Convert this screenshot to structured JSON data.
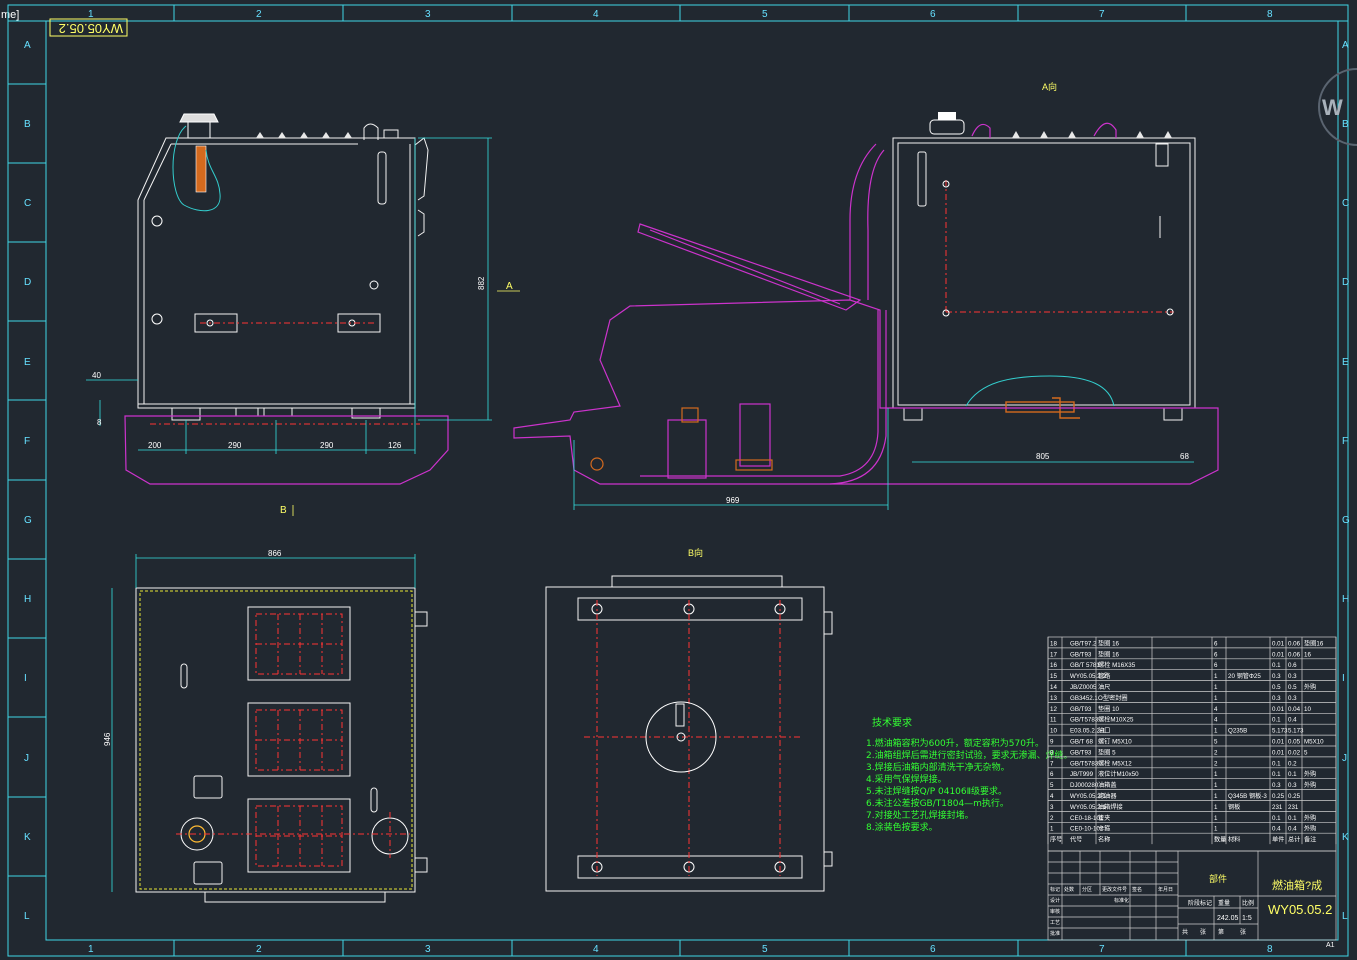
{
  "window": {
    "title_fragment": "me]"
  },
  "drawing": {
    "code_stamp": "WY05.05.2",
    "watermark": "W",
    "sheet_size": "A1",
    "grid_columns": [
      "1",
      "2",
      "3",
      "4",
      "5",
      "6",
      "7",
      "8"
    ],
    "grid_rows": [
      "A",
      "B",
      "C",
      "D",
      "E",
      "F",
      "G",
      "H",
      "I",
      "J",
      "K",
      "L"
    ]
  },
  "views": {
    "view_a_label": "A向",
    "view_b_label": "B向",
    "arrow_a": "A",
    "arrow_b": "B"
  },
  "dimensions": {
    "d40": "40",
    "d8": "8",
    "d200": "200",
    "d290a": "290",
    "d290b": "290",
    "d126": "126",
    "d882": "882",
    "d969": "969",
    "d805": "805",
    "d68": "68",
    "d866": "866",
    "d946": "946"
  },
  "tech_notes": {
    "title": "技术要求",
    "lines": [
      "1.燃油箱容积为600升，额定容积为570升。",
      "2.油箱组焊后需进行密封试验，要求无渗漏、焊缝。",
      "3.焊接后油箱内部清洗干净无杂物。",
      "4.采用气保焊焊接。",
      "5.未注焊缝按Q/P 04106Ⅱ级要求。",
      "6.未注公差按GB/T1804—m执行。",
      "7.对接处工艺孔焊接封堵。",
      "8.涂装色按要求。"
    ]
  },
  "bom": {
    "rows": [
      {
        "no": "18",
        "code": "GB/T97.2",
        "name": "垫圈 16",
        "qty": "6",
        "mat": "",
        "w1": "0.01",
        "w2": "0.06",
        "note": "垫圈16"
      },
      {
        "no": "17",
        "code": "GB/T93",
        "name": "垫圈 16",
        "qty": "6",
        "mat": "",
        "w1": "0.01",
        "w2": "0.06",
        "note": "16"
      },
      {
        "no": "16",
        "code": "GB/T 5781",
        "name": "螺栓 M16X35",
        "qty": "6",
        "mat": "",
        "w1": "0.1",
        "w2": "0.6",
        "note": ""
      },
      {
        "no": "15",
        "code": "WY05.05.2-2",
        "name": "管路",
        "qty": "1",
        "mat": "20 钢管Φ25",
        "w1": "0.3",
        "w2": "0.3",
        "note": ""
      },
      {
        "no": "14",
        "code": "JB/Z0005",
        "name": "油尺",
        "qty": "1",
        "mat": "",
        "w1": "0.5",
        "w2": "0.5",
        "note": "外购"
      },
      {
        "no": "13",
        "code": "GB3452.1",
        "name": "O型密封圈",
        "qty": "1",
        "mat": "",
        "w1": "0.3",
        "w2": "0.3",
        "note": ""
      },
      {
        "no": "12",
        "code": "GB/T93",
        "name": "垫圈 10",
        "qty": "4",
        "mat": "",
        "w1": "0.01",
        "w2": "0.04",
        "note": "10"
      },
      {
        "no": "11",
        "code": "GB/T5783",
        "name": "螺栓M10X25",
        "qty": "4",
        "mat": "",
        "w1": "0.1",
        "w2": "0.4",
        "note": ""
      },
      {
        "no": "10",
        "code": "E03.05.2.2-1",
        "name": "油口",
        "qty": "1",
        "mat": "Q235B",
        "w1": "5.173",
        "w2": "5.173",
        "note": ""
      },
      {
        "no": "9",
        "code": "GB/T 68",
        "name": "螺钉 M5X10",
        "qty": "5",
        "mat": "",
        "w1": "0.01",
        "w2": "0.05",
        "note": "M5X10"
      },
      {
        "no": "8",
        "code": "GB/T93",
        "name": "垫圈 5",
        "qty": "2",
        "mat": "",
        "w1": "0.01",
        "w2": "0.02",
        "note": "5"
      },
      {
        "no": "7",
        "code": "GB/T5783",
        "name": "螺栓 M5X12",
        "qty": "2",
        "mat": "",
        "w1": "0.1",
        "w2": "0.2",
        "note": ""
      },
      {
        "no": "6",
        "code": "JB/T999",
        "name": "液位计M10x50",
        "qty": "1",
        "mat": "",
        "w1": "0.1",
        "w2": "0.1",
        "note": "外购"
      },
      {
        "no": "5",
        "code": "DJ000280",
        "name": "油箱盖",
        "qty": "1",
        "mat": "",
        "w1": "0.3",
        "w2": "0.3",
        "note": "外购"
      },
      {
        "no": "4",
        "code": "WY05.05.2-1",
        "name": "滤油器",
        "qty": "1",
        "mat": "Q345B 钢板-3",
        "w1": "0.25",
        "w2": "0.25",
        "note": ""
      },
      {
        "no": "3",
        "code": "WY05.05.2.1",
        "name": "油箱焊接",
        "qty": "1",
        "mat": "钢板",
        "w1": "231",
        "w2": "231",
        "note": ""
      },
      {
        "no": "2",
        "code": "CE0-18-101",
        "name": "管夹",
        "qty": "1",
        "mat": "",
        "w1": "0.1",
        "w2": "0.1",
        "note": "外购"
      },
      {
        "no": "1",
        "code": "CE0-10-102",
        "name": "卡箍",
        "qty": "1",
        "mat": "",
        "w1": "0.4",
        "w2": "0.4",
        "note": "外购"
      }
    ],
    "header": [
      "序号",
      "代号",
      "名称",
      "数量",
      "材料",
      "单件",
      "总计",
      "备注"
    ]
  },
  "title_block": {
    "part_label": "部件",
    "drawing_name": "燃油箱?成",
    "drawing_number": "WY05.05.2",
    "weight": "242.05",
    "scale": "1:5",
    "stage": "阶段标记",
    "weight_label": "重量",
    "scale_label": "比例",
    "sheet_a": "共",
    "sheet_b": "张",
    "sheet_c": "第",
    "sheet_d": "张",
    "row_labels": [
      "标记",
      "处数",
      "分区",
      "更改文件号",
      "签名",
      "年月日",
      "设计",
      "标准化",
      "审核",
      "工艺",
      "批准"
    ]
  }
}
